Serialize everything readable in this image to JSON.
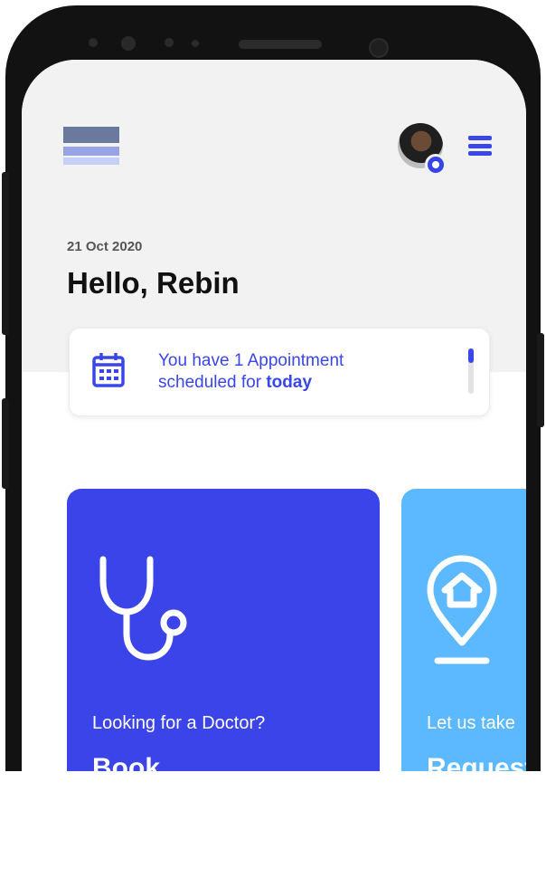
{
  "header": {
    "logo_icon": "brand-logo",
    "avatar_icon": "user-avatar",
    "menu_icon": "hamburger-menu-icon"
  },
  "greeting": {
    "date": "21 Oct 2020",
    "hello": "Hello, Rebin"
  },
  "appointment": {
    "icon": "calendar-icon",
    "line1": "You have 1 Appointment",
    "line2_prefix": "scheduled for ",
    "line2_bold": "today"
  },
  "cards": [
    {
      "icon": "stethoscope-icon",
      "subtitle": "Looking for a Doctor?",
      "title": "Book",
      "color": "#3a44e8"
    },
    {
      "icon": "home-location-icon",
      "subtitle": "Let us take",
      "title": "Request",
      "color": "#5cb8ff"
    }
  ],
  "colors": {
    "accent": "#3a47e8",
    "screen_bg": "#f2f2f2"
  }
}
